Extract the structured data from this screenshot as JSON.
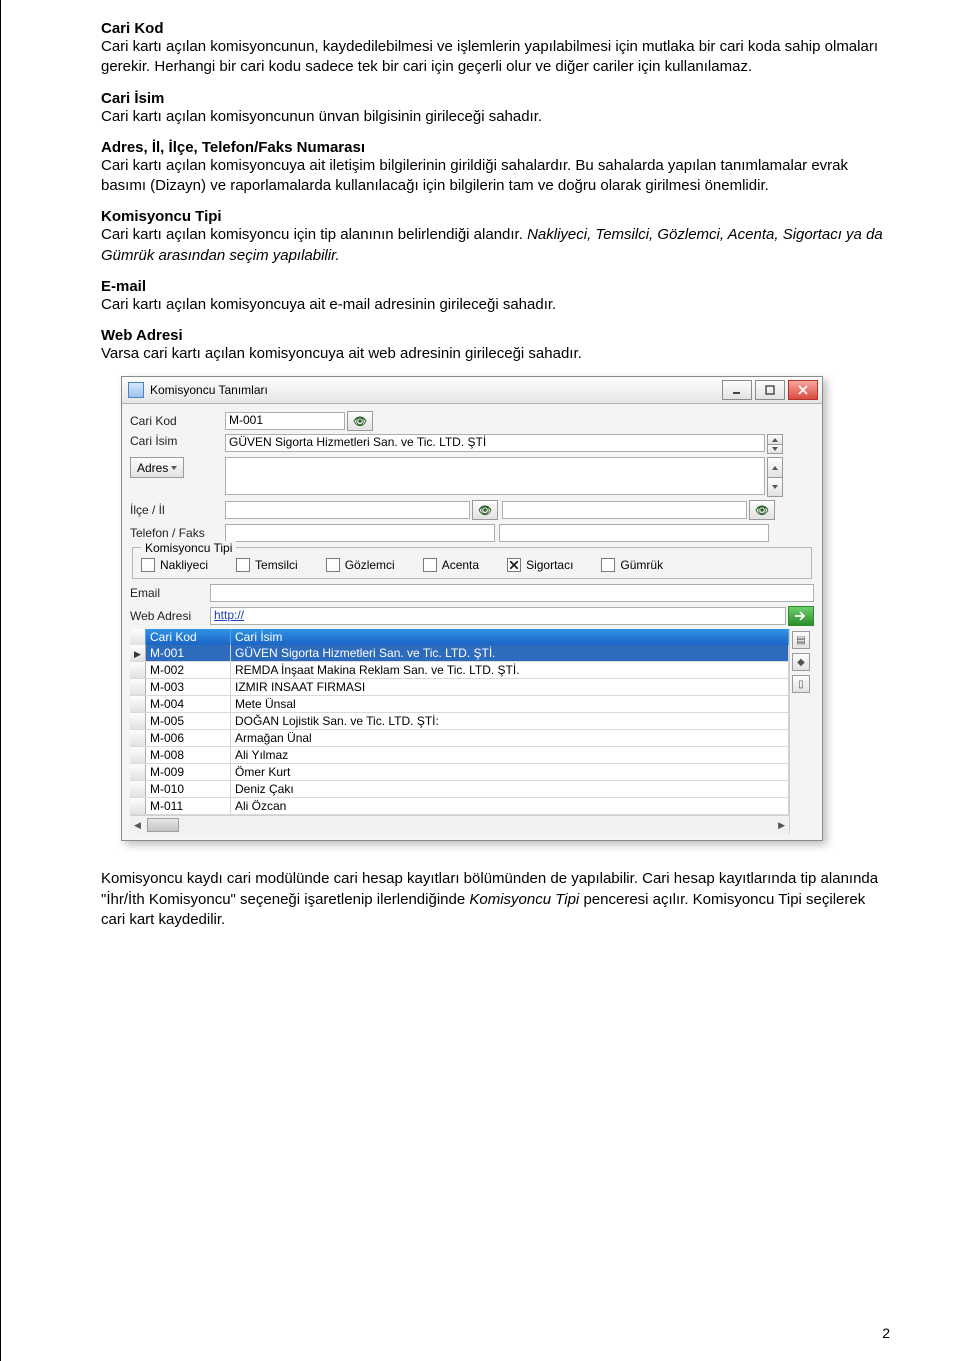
{
  "doc": {
    "sections": [
      {
        "heading": "Cari Kod",
        "body": "Cari kartı açılan komisyoncunun, kaydedilebilmesi ve işlemlerin yapılabilmesi için mutlaka bir cari koda sahip olmaları gerekir. Herhangi bir cari kodu sadece tek bir cari için geçerli olur ve diğer cariler için kullanılamaz."
      },
      {
        "heading": "Cari İsim",
        "body": "Cari kartı açılan komisyoncunun ünvan bilgisinin girileceği sahadır."
      },
      {
        "heading": "Adres, İl, İlçe, Telefon/Faks Numarası",
        "body": "Cari kartı açılan komisyoncuya ait iletişim bilgilerinin girildiği sahalardır. Bu sahalarda yapılan tanımlamalar evrak basımı (Dizayn) ve raporlamalarda kullanılacağı için bilgilerin tam ve doğru olarak girilmesi önemlidir."
      },
      {
        "heading": "Komisyoncu Tipi",
        "body": "Cari kartı açılan komisyoncu için tip alanının belirlendiği alandır. ",
        "italic": "Nakliyeci, Temsilci, Gözlemci, Acenta, Sigortacı ya da Gümrük arasından seçim yapılabilir.",
        "body2": ""
      },
      {
        "heading": "E-mail",
        "body": "Cari kartı açılan komisyoncuya ait e-mail adresinin girileceği sahadır."
      },
      {
        "heading": "Web Adresi",
        "body": "Varsa cari kartı açılan komisyoncuya ait web adresinin girileceği sahadır."
      }
    ],
    "footer": "Komisyoncu kaydı cari modülünde cari hesap kayıtları bölümünden de yapılabilir. Cari hesap kayıtlarında tip alanında \"İhr/İth Komisyoncu\" seçeneği işaretlenip ilerlendiğinde ",
    "footer_italic": "Komisyoncu Tipi",
    "footer2": " penceresi açılır. Komisyoncu Tipi seçilerek cari kart kaydedilir.",
    "page": "2"
  },
  "window": {
    "title": "Komisyoncu Tanımları",
    "labels": {
      "cariKod": "Cari Kod",
      "cariIsim": "Cari İsim",
      "adres": "Adres",
      "ilceIl": "İlçe / İl",
      "telFaks": "Telefon / Faks",
      "fieldset": "Komisyoncu Tipi",
      "email": "Email",
      "web": "Web Adresi"
    },
    "values": {
      "cariKod": "M-001",
      "cariIsim": "GÜVEN Sigorta Hizmetleri San. ve Tic. LTD. ŞTİ",
      "web": "http://"
    },
    "types": [
      {
        "name": "Nakliyeci",
        "checked": false
      },
      {
        "name": "Temsilci",
        "checked": false
      },
      {
        "name": "Gözlemci",
        "checked": false
      },
      {
        "name": "Acenta",
        "checked": false
      },
      {
        "name": "Sigortacı",
        "checked": true
      },
      {
        "name": "Gümrük",
        "checked": false
      }
    ],
    "grid": {
      "headers": [
        "Cari Kod",
        "Cari İsim"
      ],
      "rows": [
        {
          "code": "M-001",
          "name": "GÜVEN Sigorta Hizmetleri San. ve Tic. LTD. ŞTİ.",
          "selected": true
        },
        {
          "code": "M-002",
          "name": "REMDA İnşaat Makina Reklam San. ve Tic. LTD. ŞTİ."
        },
        {
          "code": "M-003",
          "name": "IZMIR INSAAT FIRMASI"
        },
        {
          "code": "M-004",
          "name": "Mete Ünsal"
        },
        {
          "code": "M-005",
          "name": "DOĞAN Lojistik San. ve Tic. LTD. ŞTİ:"
        },
        {
          "code": "M-006",
          "name": "Armağan Ünal"
        },
        {
          "code": "M-008",
          "name": "Ali Yılmaz"
        },
        {
          "code": "M-009",
          "name": "Ömer Kurt"
        },
        {
          "code": "M-010",
          "name": "Deniz Çakı"
        },
        {
          "code": "M-011",
          "name": "Ali Özcan"
        }
      ]
    }
  }
}
